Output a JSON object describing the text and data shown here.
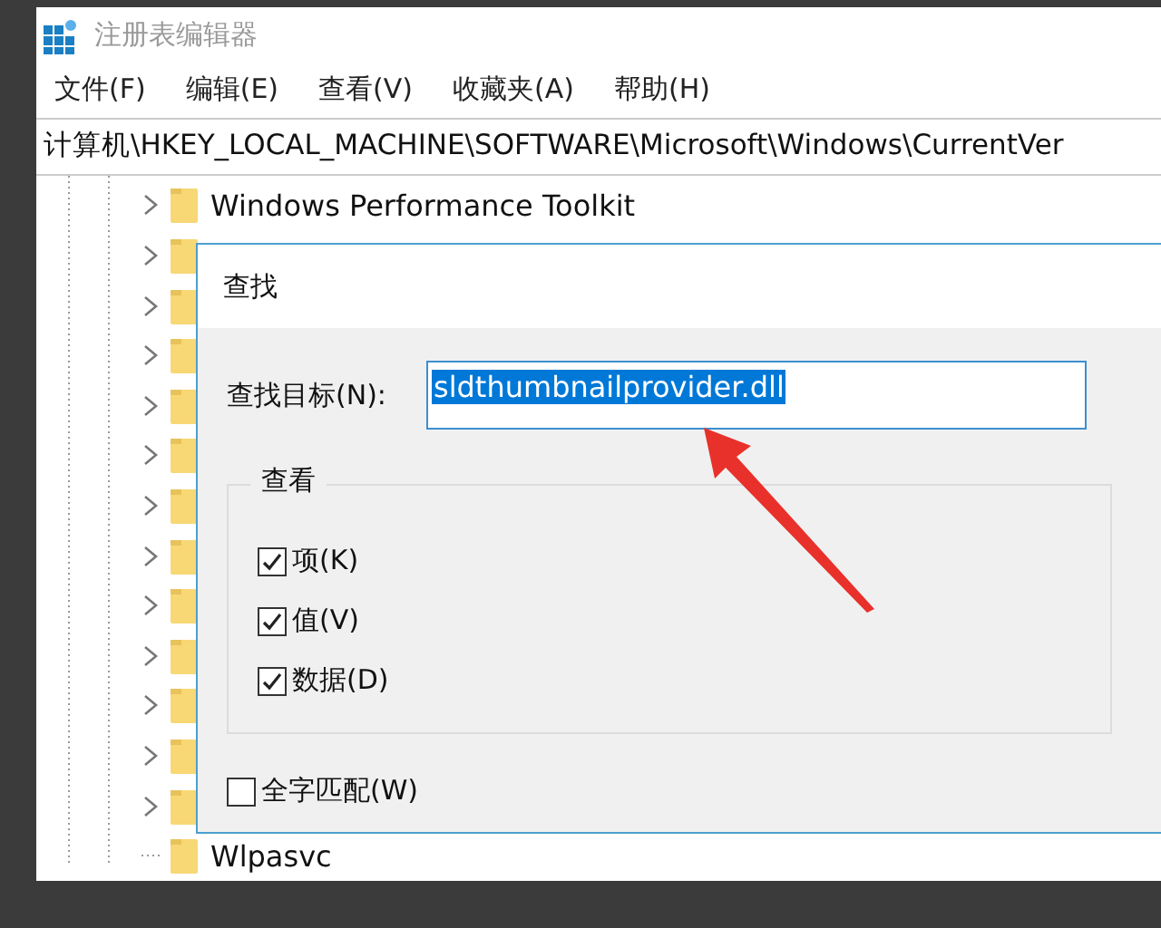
{
  "window": {
    "title": "注册表编辑器"
  },
  "menu": [
    "文件(F)",
    "编辑(E)",
    "查看(V)",
    "收藏夹(A)",
    "帮助(H)"
  ],
  "address": "计算机\\HKEY_LOCAL_MACHINE\\SOFTWARE\\Microsoft\\Windows\\CurrentVer",
  "tree": [
    {
      "label": "Windows Performance Toolkit",
      "expandable": true
    },
    {
      "expandable": true
    },
    {
      "expandable": true
    },
    {
      "expandable": true
    },
    {
      "expandable": true
    },
    {
      "expandable": true
    },
    {
      "expandable": true
    },
    {
      "expandable": true
    },
    {
      "expandable": true
    },
    {
      "expandable": true
    },
    {
      "expandable": true
    },
    {
      "expandable": true
    },
    {
      "expandable": true
    },
    {
      "label": "Wlpasvc",
      "expandable": false
    }
  ],
  "dialog": {
    "title": "查找",
    "find_label": "查找目标(N):",
    "find_value": "sldthumbnailprovider.dll",
    "value_selected": true,
    "group": {
      "title": "查看",
      "options": [
        {
          "label": "项(K)",
          "checked": true
        },
        {
          "label": "值(V)",
          "checked": true
        },
        {
          "label": "数据(D)",
          "checked": true
        }
      ]
    },
    "whole_word": {
      "label": "全字匹配(W)",
      "checked": false
    }
  }
}
